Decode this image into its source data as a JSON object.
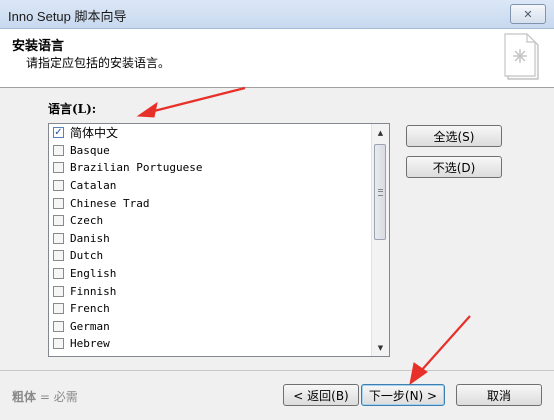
{
  "window": {
    "title": "Inno Setup 脚本向导",
    "close_label": "✕"
  },
  "header": {
    "title": "安装语言",
    "subtitle": "请指定应包括的安装语言。"
  },
  "language_label": "语言(L):",
  "languages": [
    {
      "name": "简体中文",
      "checked": true
    },
    {
      "name": "Basque",
      "checked": false
    },
    {
      "name": "Brazilian Portuguese",
      "checked": false
    },
    {
      "name": "Catalan",
      "checked": false
    },
    {
      "name": "Chinese Trad",
      "checked": false
    },
    {
      "name": "Czech",
      "checked": false
    },
    {
      "name": "Danish",
      "checked": false
    },
    {
      "name": "Dutch",
      "checked": false
    },
    {
      "name": "English",
      "checked": false
    },
    {
      "name": "Finnish",
      "checked": false
    },
    {
      "name": "French",
      "checked": false
    },
    {
      "name": "German",
      "checked": false
    },
    {
      "name": "Hebrew",
      "checked": false
    }
  ],
  "buttons": {
    "select_all": "全选(S)",
    "select_none": "不选(D)",
    "back": "< 返回(B)",
    "next": "下一步(N) >",
    "cancel": "取消"
  },
  "footer": {
    "bold_word": "粗体",
    "rest": " = 必需"
  },
  "colors": {
    "annotation_arrow": "#e8302a",
    "title_bar": "#c8d9ef"
  }
}
